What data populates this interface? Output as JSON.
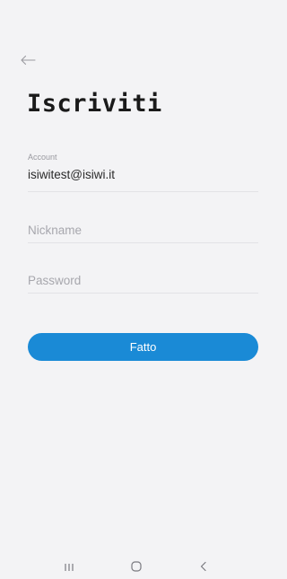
{
  "header": {
    "back_icon": "arrow-left-icon",
    "title": "Iscriviti"
  },
  "form": {
    "account": {
      "label": "Account",
      "value": "isiwitest@isiwi.it"
    },
    "nickname": {
      "placeholder": "Nickname",
      "value": ""
    },
    "password": {
      "placeholder": "Password",
      "value": ""
    },
    "submit_label": "Fatto"
  },
  "navigation_bar": {
    "recents_icon": "recents-icon",
    "home_icon": "home-icon",
    "back_icon": "chevron-left-icon"
  },
  "colors": {
    "background": "#f3f3f5",
    "accent": "#1a8ad6",
    "divider": "#e2e2e6"
  }
}
